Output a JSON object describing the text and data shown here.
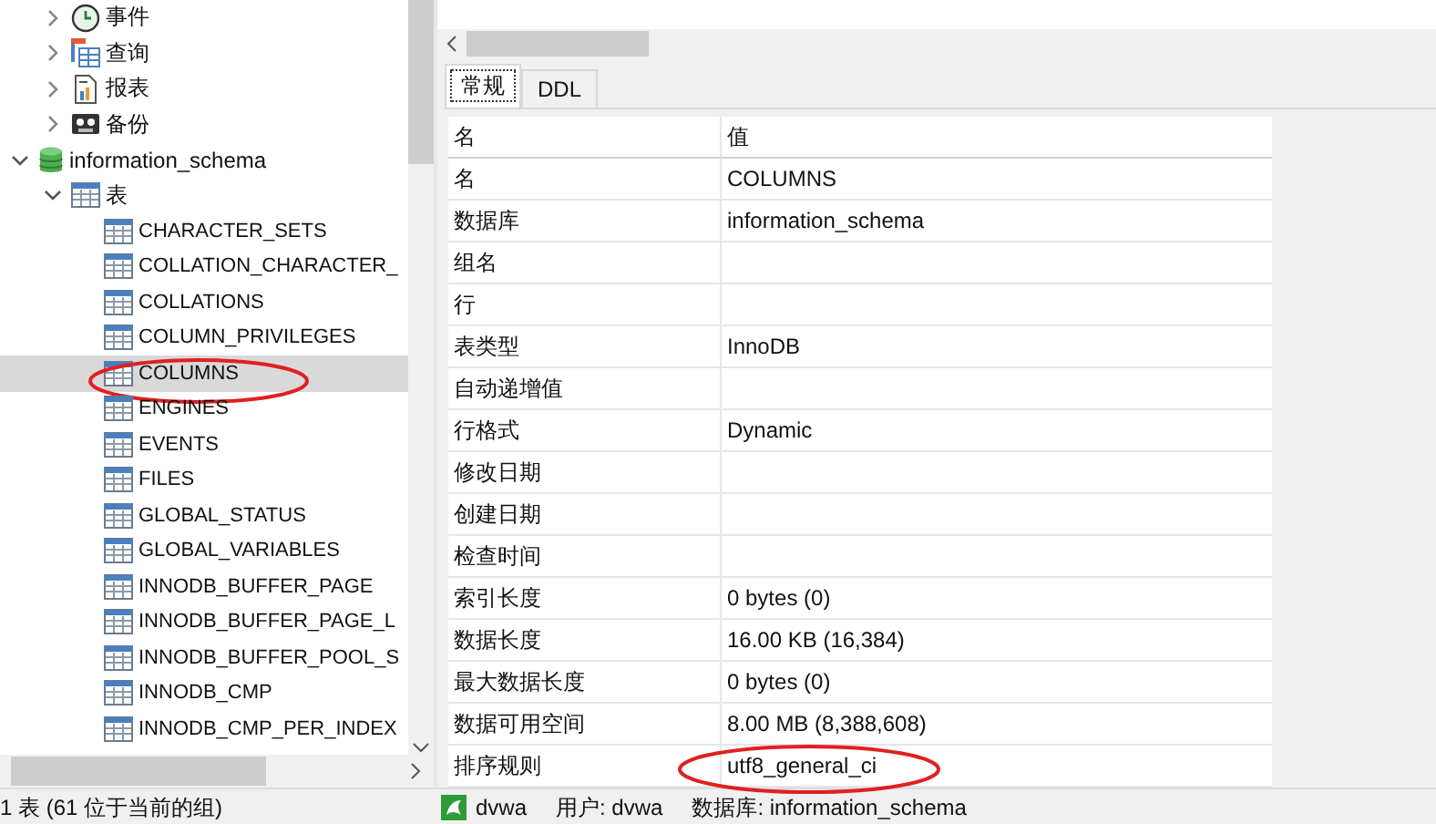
{
  "tree": {
    "continued_items": [
      {
        "label": "事件",
        "kind": "event",
        "expanded": false
      },
      {
        "label": "查询",
        "kind": "query",
        "expanded": false
      },
      {
        "label": "报表",
        "kind": "report",
        "expanded": false
      },
      {
        "label": "备份",
        "kind": "backup",
        "expanded": false
      }
    ],
    "items": [
      {
        "label": "information_schema",
        "kind": "database",
        "expanded": true,
        "children": [
          {
            "label": "表",
            "kind": "tables",
            "expanded": true,
            "children": [
              {
                "label": "CHARACTER_SETS",
                "kind": "table",
                "selected": false,
                "annotated": false
              },
              {
                "label": "COLLATION_CHARACTER_",
                "kind": "table",
                "selected": false,
                "annotated": false
              },
              {
                "label": "COLLATIONS",
                "kind": "table",
                "selected": false,
                "annotated": false
              },
              {
                "label": "COLUMN_PRIVILEGES",
                "kind": "table",
                "selected": false,
                "annotated": false
              },
              {
                "label": "COLUMNS",
                "kind": "table",
                "selected": true,
                "annotated": true
              },
              {
                "label": "ENGINES",
                "kind": "table",
                "selected": false,
                "annotated": false
              },
              {
                "label": "EVENTS",
                "kind": "table",
                "selected": false,
                "annotated": false
              },
              {
                "label": "FILES",
                "kind": "table",
                "selected": false,
                "annotated": false
              },
              {
                "label": "GLOBAL_STATUS",
                "kind": "table",
                "selected": false,
                "annotated": false
              },
              {
                "label": "GLOBAL_VARIABLES",
                "kind": "table",
                "selected": false,
                "annotated": false
              },
              {
                "label": "INNODB_BUFFER_PAGE",
                "kind": "table",
                "selected": false,
                "annotated": false
              },
              {
                "label": "INNODB_BUFFER_PAGE_L",
                "kind": "table",
                "selected": false,
                "annotated": false
              },
              {
                "label": "INNODB_BUFFER_POOL_S",
                "kind": "table",
                "selected": false,
                "annotated": false
              },
              {
                "label": "INNODB_CMP",
                "kind": "table",
                "selected": false,
                "annotated": false
              },
              {
                "label": "INNODB_CMP_PER_INDEX",
                "kind": "table",
                "selected": false,
                "annotated": false
              }
            ]
          }
        ]
      }
    ]
  },
  "left_status": "1 表 (61 位于当前的组)",
  "tabs": [
    {
      "label": "常规",
      "selected": true
    },
    {
      "label": "DDL",
      "selected": false
    }
  ],
  "properties": {
    "columns": [
      "名",
      "值"
    ],
    "rows": [
      {
        "name": "名",
        "value": "COLUMNS",
        "annotated": false
      },
      {
        "name": "数据库",
        "value": "information_schema",
        "annotated": false
      },
      {
        "name": "组名",
        "annotated": false
      },
      {
        "name": "行",
        "annotated": false
      },
      {
        "name": "表类型",
        "value": "InnoDB",
        "annotated": false
      },
      {
        "name": "自动递增值",
        "annotated": false
      },
      {
        "name": "行格式",
        "value": "Dynamic",
        "annotated": false
      },
      {
        "name": "修改日期",
        "annotated": false
      },
      {
        "name": "创建日期",
        "annotated": false
      },
      {
        "name": "检查时间",
        "annotated": false
      },
      {
        "name": "索引长度",
        "value": "0 bytes (0)",
        "annotated": false
      },
      {
        "name": "数据长度",
        "value": "16.00 KB (16,384)",
        "annotated": false
      },
      {
        "name": "最大数据长度",
        "value": "0 bytes (0)",
        "annotated": false
      },
      {
        "name": "数据可用空间",
        "value": "8.00 MB (8,388,608)",
        "annotated": false
      },
      {
        "name": "排序规则",
        "value": "utf8_general_ci",
        "annotated": true
      }
    ]
  },
  "status_bar": {
    "connection": "dvwa",
    "user": "用户: dvwa",
    "database": "数据库: information_schema"
  }
}
